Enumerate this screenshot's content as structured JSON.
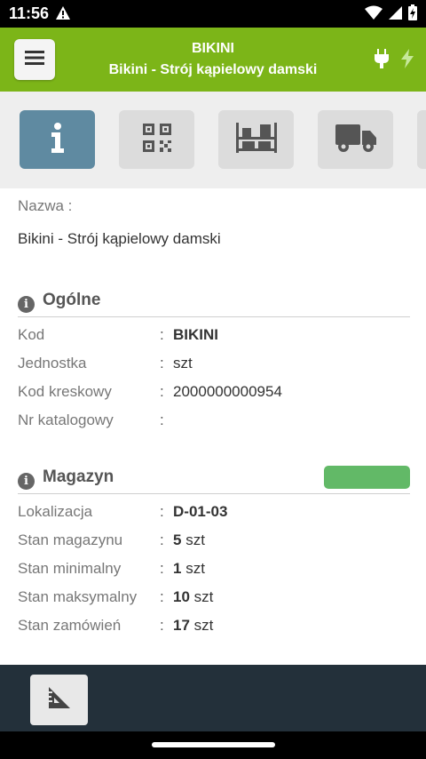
{
  "status_bar": {
    "time": "11:56",
    "icons": [
      "alert-icon",
      "wifi-icon",
      "signal-icon",
      "battery-icon"
    ]
  },
  "header": {
    "title": "BIKINI",
    "subtitle": "Bikini - Strój kąpielowy damski",
    "accent_color": "#7cb518",
    "icons": [
      "plug-icon",
      "bolt-icon"
    ]
  },
  "tabs": [
    {
      "name": "info",
      "icon": "info-icon",
      "active": true
    },
    {
      "name": "qr-code",
      "icon": "qr-code-icon",
      "active": false
    },
    {
      "name": "warehouse",
      "icon": "shelves-icon",
      "active": false
    },
    {
      "name": "delivery",
      "icon": "truck-icon",
      "active": false
    }
  ],
  "name_field": {
    "label": "Nazwa :",
    "value": "Bikini - Strój kąpielowy damski"
  },
  "general": {
    "title": "Ogólne",
    "rows": [
      {
        "label": "Kod",
        "sep": ":",
        "value": "BIKINI",
        "unit": ""
      },
      {
        "label": "Jednostka",
        "sep": ":",
        "value": "szt",
        "unit": ""
      },
      {
        "label": "Kod kreskowy",
        "sep": ":",
        "value": "2000000000954",
        "unit": ""
      },
      {
        "label": "Nr katalogowy",
        "sep": ":",
        "value": "",
        "unit": ""
      }
    ]
  },
  "warehouse": {
    "title": "Magazyn",
    "status_color": "#62b967",
    "rows": [
      {
        "label": "Lokalizacja",
        "sep": ":",
        "value": "D-01-03",
        "unit": ""
      },
      {
        "label": "Stan magazynu",
        "sep": ":",
        "value": "5",
        "unit": "szt"
      },
      {
        "label": "Stan minimalny",
        "sep": ":",
        "value": "1",
        "unit": "szt"
      },
      {
        "label": "Stan maksymalny",
        "sep": ":",
        "value": "10",
        "unit": "szt"
      },
      {
        "label": "Stan zamówień",
        "sep": ":",
        "value": "17",
        "unit": "szt"
      }
    ]
  },
  "bottom_bar": {
    "icon": "ruler-icon"
  }
}
